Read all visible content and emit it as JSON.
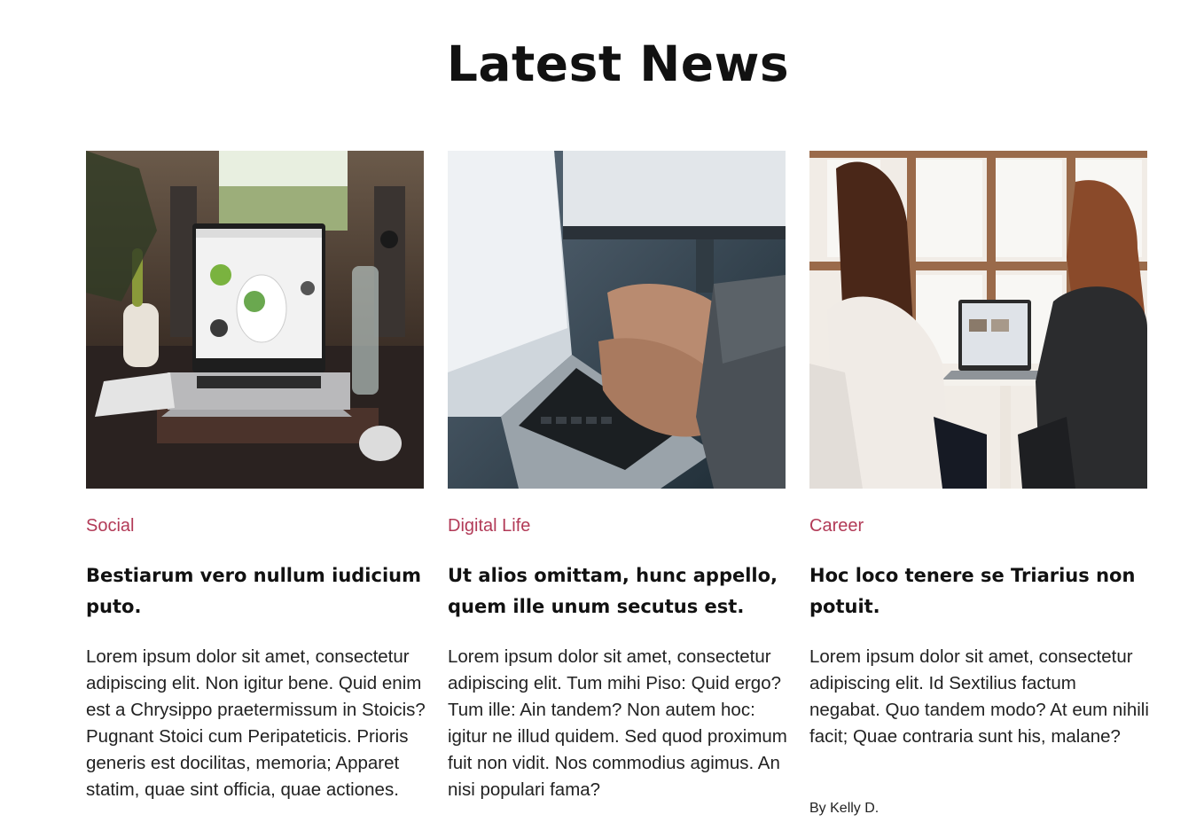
{
  "section": {
    "title": "Latest News"
  },
  "colors": {
    "category": "#b23a57",
    "heading": "#111111",
    "text": "#222222"
  },
  "posts": [
    {
      "image": "laptop-on-desk-photo",
      "category": "Social",
      "title": "Bestiarum vero nullum iudicium puto.",
      "excerpt": "Lorem ipsum dolor sit amet, consectetur adipiscing elit. Non igitur bene. Quid enim est a Chrysippo praetermissum in Stoicis? Pugnant Stoici cum Peripateticis. Prioris generis est docilitas, memoria; Apparet statim, quae sint officia, quae actiones."
    },
    {
      "image": "hands-typing-laptop-photo",
      "category": "Digital Life",
      "title": "Ut alios omittam, hunc appello, quem ille unum secutus est.",
      "excerpt": "Lorem ipsum dolor sit amet, consectetur adipiscing elit. Tum mihi Piso: Quid ergo? Tum ille: Ain tandem? Non autem hoc: igitur ne illud quidem. Sed quod proximum fuit non vidit. Nos commodius agimus. An nisi populari fama?"
    },
    {
      "image": "two-women-at-laptop-photo",
      "category": "Career",
      "title": "Hoc loco tenere se Triarius non potuit.",
      "excerpt": "Lorem ipsum dolor sit amet, consectetur adipiscing elit. Id Sextilius factum negabat. Quo tandem modo? At eum nihili facit; Quae contraria sunt his, malane?",
      "author": "By Kelly D."
    }
  ]
}
